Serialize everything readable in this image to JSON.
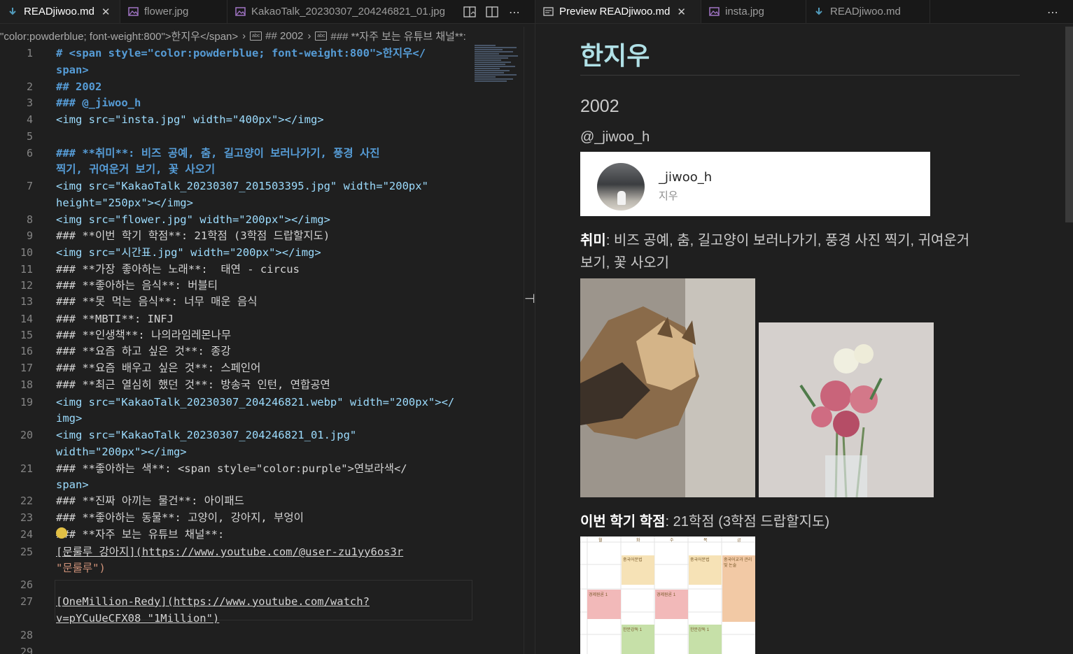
{
  "left_tabs": [
    {
      "label": "READjiwoo.md",
      "icon": "markdown-icon",
      "active": true
    },
    {
      "label": "flower.jpg",
      "icon": "image-icon",
      "active": false
    },
    {
      "label": "KakaoTalk_20230307_204246821_01.jpg",
      "icon": "image-icon",
      "active": false
    }
  ],
  "right_tabs": [
    {
      "label": "Preview READjiwoo.md",
      "icon": "preview-icon",
      "active": true
    },
    {
      "label": "insta.jpg",
      "icon": "image-icon",
      "active": false
    },
    {
      "label": "READjiwoo.md",
      "icon": "markdown-icon",
      "active": false
    }
  ],
  "breadcrumb": {
    "part1": "\"color:powderblue; font-weight:800\">한지우</span>",
    "part2": "## 2002",
    "part3": "### **자주 보는 유튜브 채널**:"
  },
  "line_numbers": [
    "1",
    "2",
    "3",
    "4",
    "5",
    "6",
    "7",
    "8",
    "9",
    "10",
    "11",
    "12",
    "13",
    "14",
    "15",
    "16",
    "17",
    "18",
    "19",
    "20",
    "21",
    "22",
    "23",
    "24",
    "25",
    "26",
    "27",
    "28",
    "29"
  ],
  "code": {
    "l1a": "# <span style=\"color:powderblue; font-weight:800\">한지우</",
    "l1b": "span>",
    "l2": "## 2002",
    "l3": "### @_jiwoo_h",
    "l4": "<img src=\"insta.jpg\" width=\"400px\"></img>",
    "l6a": "### **취미**: 비즈 공예, 춤, 길고양이 보러나가기, 풍경 사진",
    "l6b": "찍기, 귀여운거 보기, 꽃 사오기",
    "l7a": "<img src=\"KakaoTalk_20230307_201503395.jpg\" width=\"200px\"",
    "l7b": "height=\"250px\"></img>",
    "l8": "<img src=\"flower.jpg\" width=\"200px\"></img>",
    "l9": "### **이번 학기 학점**: 21학점 (3학점 드랍할지도)",
    "l10": "<img src=\"시간표.jpg\" width=\"200px\"></img>",
    "l11": "### **가장 좋아하는 노래**:  태연 - circus",
    "l12": "### **좋아하는 음식**: 버블티",
    "l13": "### **못 먹는 음식**: 너무 매운 음식",
    "l14": "### **MBTI**: INFJ",
    "l15": "### **인생책**: 나의라임레몬나무",
    "l16": "### **요즘 하고 싶은 것**: 종강",
    "l17": "### **요즘 배우고 싶은 것**: 스페인어",
    "l18": "### **최근 열심히 했던 것**: 방송국 인턴, 연합공연",
    "l19a": "<img src=\"KakaoTalk_20230307_204246821.webp\" width=\"200px\"></",
    "l19b": "img>",
    "l20a": "<img src=\"KakaoTalk_20230307_204246821_01.jpg\"",
    "l20b": "width=\"200px\"></img>",
    "l21a": "### **좋아하는 색**: <span style=\"color:purple\">연보라색</",
    "l21b": "span>",
    "l22": "### **진짜 아끼는 물건**: 아이패드",
    "l23": "### **좋아하는 동물**: 고양이, 강아지, 부엉이",
    "l24": "### **자주 보는 유튜브 채널**:",
    "l25a": "[문룰루 강아지](https://www.youtube.com/@user-zu1yy6os3r",
    "l25b": "\"문룰루\")",
    "l27a": "[OneMillion-Redy](https://www.youtube.com/watch?",
    "l27b": "v=pYCuUeCFX08 \"1Million\")"
  },
  "preview": {
    "title": "한지우",
    "title_color": "#b0e0e6",
    "year": "2002",
    "handle": "@_jiwoo_h",
    "insta_user": "_jiwoo_h",
    "insta_name": "지우",
    "hobby_label": "취미",
    "hobby_text_1": ": 비즈 공예, 춤, 길고양이 보러나가기, 풍경 사진 찍기, 귀여운거",
    "hobby_text_2": "보기, 꽃 사오기",
    "credit_label": "이번 학기 학점",
    "credit_text": ": 21학점 (3학점 드랍할지도)",
    "timetable": {
      "days": [
        "월",
        "화",
        "수",
        "목",
        "금"
      ],
      "cells": [
        "중국어문법",
        "중국어문법",
        "중국어교과 관리 및 논술",
        "경제원론 1",
        "경제원론 1",
        "한문강독 1",
        "한문강독 1"
      ]
    }
  },
  "colors": {
    "editor_bg": "#1f1f1f",
    "tabbar_bg": "#181818",
    "keyword_blue": "#569cd6",
    "attr_lightblue": "#9cdcfe",
    "string_orange": "#ce9178"
  }
}
